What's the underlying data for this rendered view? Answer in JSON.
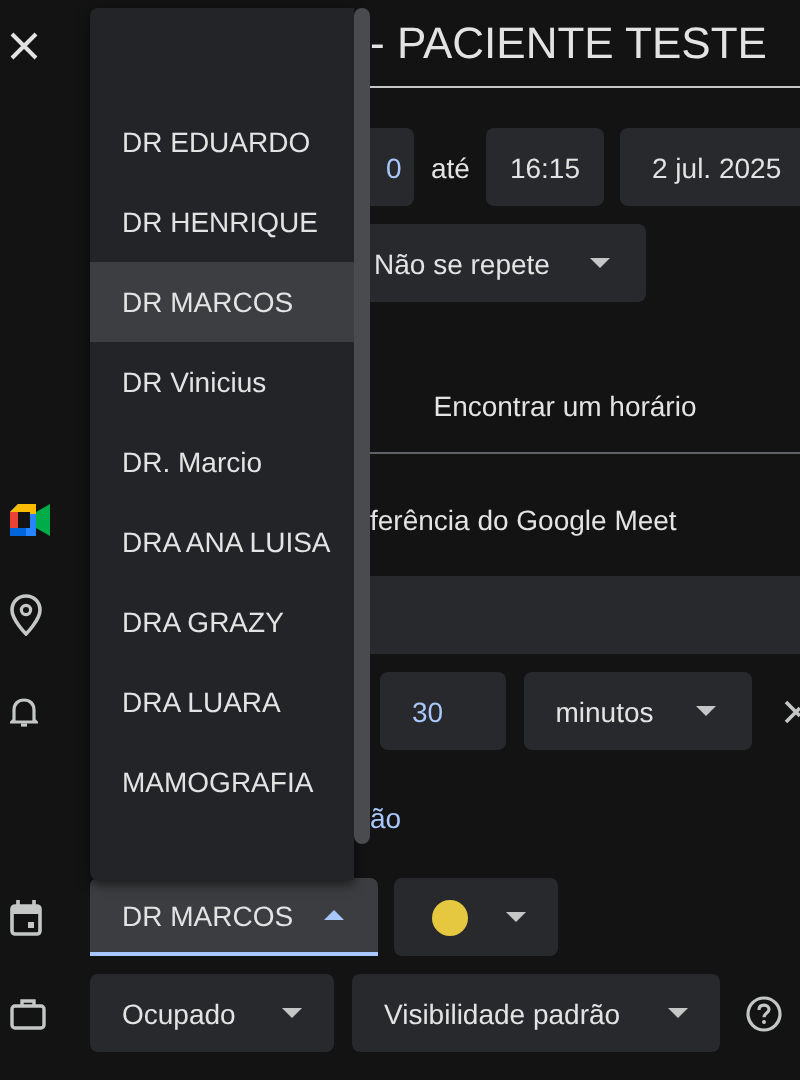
{
  "title": "- PACIENTE TESTE",
  "time": {
    "start": "0",
    "separator": "até",
    "end": "16:15",
    "date": "2 jul. 2025"
  },
  "repeat": "Não se repete",
  "find_time": "Encontrar um horário",
  "conference": "ferência do Google Meet",
  "notification": {
    "value": "30",
    "unit": "minutos"
  },
  "link": "ão",
  "calendar": {
    "value": "DR MARCOS",
    "expanded": true,
    "color": "#e6c840"
  },
  "menu": {
    "items": [
      {
        "label": "DR EDUARDO",
        "selected": false
      },
      {
        "label": "DR HENRIQUE",
        "selected": false
      },
      {
        "label": "DR MARCOS",
        "selected": true
      },
      {
        "label": "DR Vinicius",
        "selected": false
      },
      {
        "label": "DR. Marcio",
        "selected": false
      },
      {
        "label": "DRA ANA LUISA",
        "selected": false
      },
      {
        "label": "DRA GRAZY",
        "selected": false
      },
      {
        "label": "DRA LUARA",
        "selected": false
      },
      {
        "label": "MAMOGRAFIA",
        "selected": false
      }
    ]
  },
  "availability": "Ocupado",
  "visibility": "Visibilidade padrão"
}
